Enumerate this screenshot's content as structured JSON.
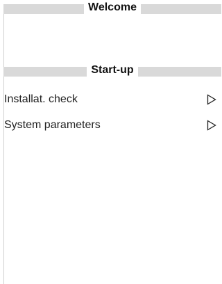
{
  "header": {
    "welcome_title": "Welcome",
    "startup_title": "Start-up"
  },
  "menu": {
    "items": [
      {
        "label": "Installat. check",
        "icon": "triangle-right-icon"
      },
      {
        "label": "System parameters",
        "icon": "triangle-right-icon"
      }
    ]
  },
  "colors": {
    "bar": "#d9d9d9",
    "text": "#111111",
    "background": "#ffffff"
  }
}
